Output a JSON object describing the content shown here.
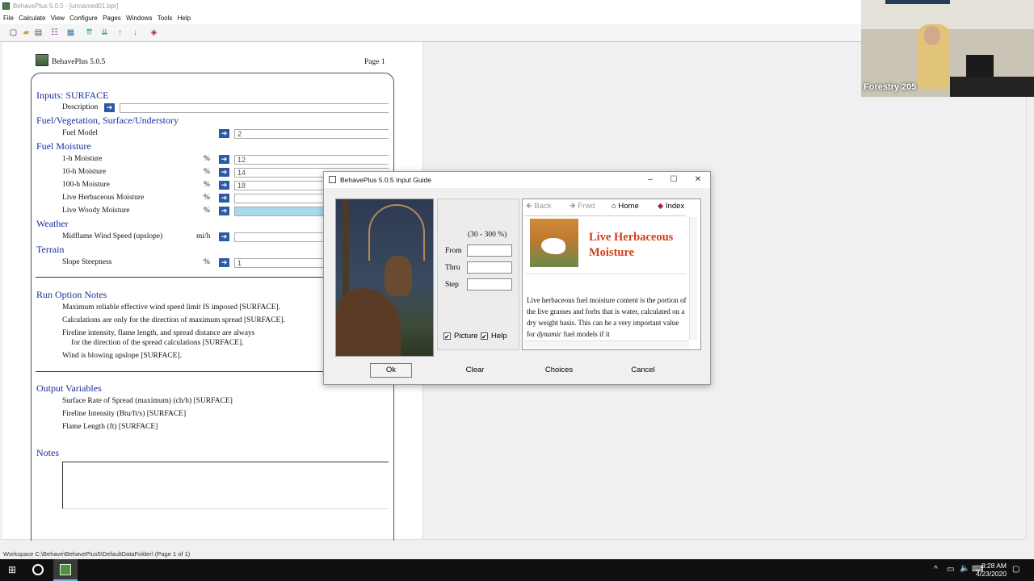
{
  "window": {
    "title": "BehavePlus 5.0.5 - [unnamed01.bpr]",
    "menus": [
      "File",
      "Calculate",
      "View",
      "Configure",
      "Pages",
      "Windows",
      "Tools",
      "Help"
    ]
  },
  "worksheet": {
    "app_name": "BehavePlus 5.0.5",
    "page_label": "Page 1",
    "inputs_title": "Inputs: SURFACE",
    "description_label": "Description",
    "sections": [
      {
        "title": "Fuel/Vegetation, Surface/Understory"
      },
      {
        "title": "Fuel Moisture"
      },
      {
        "title": "Weather"
      },
      {
        "title": "Terrain"
      }
    ],
    "rows": [
      {
        "label": "Fuel Model",
        "unit": "",
        "value": "2"
      },
      {
        "label": "1-h Moisture",
        "unit": "%",
        "value": "12"
      },
      {
        "label": "10-h Moisture",
        "unit": "%",
        "value": "14"
      },
      {
        "label": "100-h Moisture",
        "unit": "%",
        "value": "18"
      },
      {
        "label": "Live Herbaceous Moisture",
        "unit": "%",
        "value": ""
      },
      {
        "label": "Live Woody Moisture",
        "unit": "%",
        "value": ""
      },
      {
        "label": "Midflame Wind Speed (upslope)",
        "unit": "mi/h",
        "value": ""
      },
      {
        "label": "Slope Steepness",
        "unit": "%",
        "value": "1"
      }
    ],
    "run_notes_title": "Run Option Notes",
    "run_notes": [
      "Maximum reliable effective wind speed limit IS imposed [SURFACE].",
      "Calculations are only for the direction of maximum spread [SURFACE].",
      "Fireline intensity, flame length, and spread distance are always",
      "for the direction of the spread calculations [SURFACE].",
      "Wind is blowing upslope [SURFACE]."
    ],
    "output_title": "Output Variables",
    "outputs": [
      "Surface Rate of Spread (maximum)  (ch/h)  [SURFACE]",
      "Fireline Intensity  (Btu/ft/s)  [SURFACE]",
      "Flame Length  (ft)  [SURFACE]"
    ],
    "notes_title": "Notes"
  },
  "webcam": {
    "label": "Forestry 205"
  },
  "dialog": {
    "title": "BehavePlus 5.0.5 Input Guide",
    "range": "(30 - 300 %)",
    "from_label": "From",
    "thru_label": "Thru",
    "step_label": "Step",
    "picture_label": "Picture",
    "help_label": "Help",
    "picture_checked": true,
    "help_checked": true,
    "nav": {
      "back": "Back",
      "fwd": "Frwd",
      "home": "Home",
      "index": "Index"
    },
    "help_title": "Live Herbaceous Moisture",
    "help_body_1": "Live herbaceous fuel moisture content is the portion of the live grasses and forbs that is water, calculated on a dry weight basis. This can be a very important value for",
    "help_body_em": "dynamic",
    "help_body_2": "fuel models if it",
    "buttons": {
      "ok": "Ok",
      "clear": "Clear",
      "choices": "Choices",
      "cancel": "Cancel"
    }
  },
  "status": {
    "text": "Workspace C:\\Behave\\BehavePlus5\\DefaultDataFolder\\  (Page 1 of 1)"
  },
  "taskbar": {
    "time": "8:28 AM",
    "date": "4/23/2020"
  },
  "colors": {
    "section_blue": "#1a2fa0",
    "help_title": "#d0401a",
    "arrow_blue": "#2b5aa6"
  }
}
